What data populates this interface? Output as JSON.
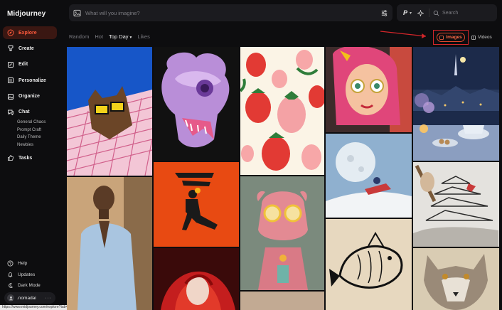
{
  "app": {
    "name": "Midjourney"
  },
  "sidebar": {
    "items": [
      {
        "id": "explore",
        "label": "Explore",
        "icon": "compass-icon",
        "active": true
      },
      {
        "id": "create",
        "label": "Create",
        "icon": "brush-icon",
        "active": false
      },
      {
        "id": "edit",
        "label": "Edit",
        "icon": "pencil-icon",
        "active": false
      },
      {
        "id": "personalize",
        "label": "Personalize",
        "icon": "sliders-icon",
        "active": false
      },
      {
        "id": "organize",
        "label": "Organize",
        "icon": "image-folder-icon",
        "active": false
      },
      {
        "id": "chat",
        "label": "Chat",
        "icon": "chat-icon",
        "active": false
      }
    ],
    "chat_channels": [
      "General Chaos",
      "Prompt Craft",
      "Daily Theme",
      "Newbies"
    ],
    "tasks": {
      "label": "Tasks",
      "icon": "thumbs-up-icon"
    },
    "bottom": [
      {
        "label": "Help",
        "icon": "help-icon"
      },
      {
        "label": "Updates",
        "icon": "bell-icon"
      },
      {
        "label": "Dark Mode",
        "icon": "moon-icon"
      }
    ],
    "user": {
      "name": ".nomadai",
      "more": "···"
    }
  },
  "topbar": {
    "prompt_placeholder": "What will you imagine?",
    "model_letter": "P",
    "search_placeholder": "Search"
  },
  "filters": {
    "items": [
      {
        "label": "Random",
        "selected": false
      },
      {
        "label": "Hot",
        "selected": false
      },
      {
        "label": "Top Day",
        "selected": true,
        "has_dropdown": true
      },
      {
        "label": "Likes",
        "selected": false
      }
    ]
  },
  "media_tabs": {
    "images": "Images",
    "videos": "Videos",
    "active": "images"
  },
  "status_bar": {
    "url": "https://www.midjourney.com/explore?tab=top"
  },
  "colors": {
    "accent": "#ff5a3c",
    "active_bg": "#3a1712",
    "highlight_box": "#d4262a",
    "background": "#0d0d0f"
  },
  "gallery": {
    "tiles": [
      {
        "name": "cat-with-sunglasses-tile"
      },
      {
        "name": "purple-dragon-skull-tile"
      },
      {
        "name": "strawberry-pattern-tile"
      },
      {
        "name": "pink-hair-girl-tile"
      },
      {
        "name": "night-tea-scene-tile"
      },
      {
        "name": "man-portrait-tile"
      },
      {
        "name": "orange-figure-tile"
      },
      {
        "name": "moon-snowmobile-tile"
      },
      {
        "name": "pink-alien-tile"
      },
      {
        "name": "pagoda-sketch-tile"
      },
      {
        "name": "fish-sketch-tile"
      },
      {
        "name": "red-hair-woman-tile"
      },
      {
        "name": "wolf-sketch-tile"
      }
    ]
  }
}
